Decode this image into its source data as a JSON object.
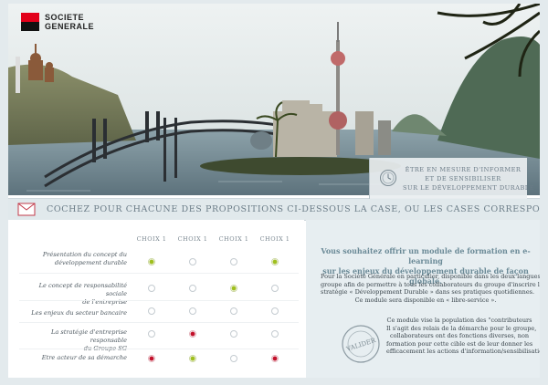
{
  "brand": {
    "line1": "SOCIETE",
    "line2": "GENERALE",
    "colors": {
      "red": "#e2001a",
      "black": "#111111"
    }
  },
  "banner": {
    "info_lines": [
      "ÊTRE EN MESURE D'INFORMER",
      "ET DE SENSIBILISER",
      "SUR LE DÉVELOPPEMENT DURABLE"
    ],
    "icon": "clock-icon"
  },
  "instruction": {
    "icon": "envelope-icon",
    "text": "COCHEZ POUR CHACUNE DES PROPOSITIONS CI-DESSOUS LA CASE, OU LES CASES CORRESPONDANTES. PUIS VALIDEZ."
  },
  "quiz": {
    "columns": [
      "CHOIX 1",
      "CHOIX 1",
      "CHOIX 1",
      "CHOIX 1"
    ],
    "rows": [
      {
        "label_line1": "Présentation du concept du",
        "label_line2": "développement durable",
        "choices": [
          "green",
          "none",
          "none",
          "green"
        ]
      },
      {
        "label_line1": "Le concept de responsabilité sociale",
        "label_line2": "de l'entreprise",
        "choices": [
          "none",
          "none",
          "green",
          "none"
        ]
      },
      {
        "label_line1": "Les enjeux du secteur bancaire",
        "label_line2": "",
        "choices": [
          "none",
          "none",
          "none",
          "none"
        ]
      },
      {
        "label_line1": "La stratégie d'entreprise responsable",
        "label_line2": "du Groupe SG",
        "choices": [
          "none",
          "red",
          "none",
          "none"
        ]
      },
      {
        "label_line1": "Etre acteur de sa démarche",
        "label_line2": "",
        "choices": [
          "red",
          "green",
          "none",
          "red"
        ]
      }
    ],
    "selected_colors": {
      "green": "#9fbf1e",
      "red": "#c2102a"
    }
  },
  "info_panel": {
    "title_line1": "Vous souhaitez offrir un module de formation en e-learning",
    "title_line2": "sur les enjeux du développement durable de façon globale.",
    "body_lines": [
      "Pour la Société Générale en particulier, disponible dans les deux langues du",
      "groupe afin de permettre à tous les collaborateurs du groupe d'inscrire la",
      "stratégie « Développement Durable » dans ses pratiques quotidiennes.",
      "Ce module sera disponible en « libre-service »."
    ],
    "foot_lines": [
      "Ce module vise la population des \"contributeurs",
      "Il s'agit des relais de la démarche pour le groupe,",
      "collaborateurs ont des fonctions diverses, non",
      "formation pour cette cible est de leur donner les",
      "efficacement  les actions d'information/sensibilisation ."
    ],
    "stamp_label": "VALIDER",
    "stamp_icon": "stamp-icon"
  }
}
